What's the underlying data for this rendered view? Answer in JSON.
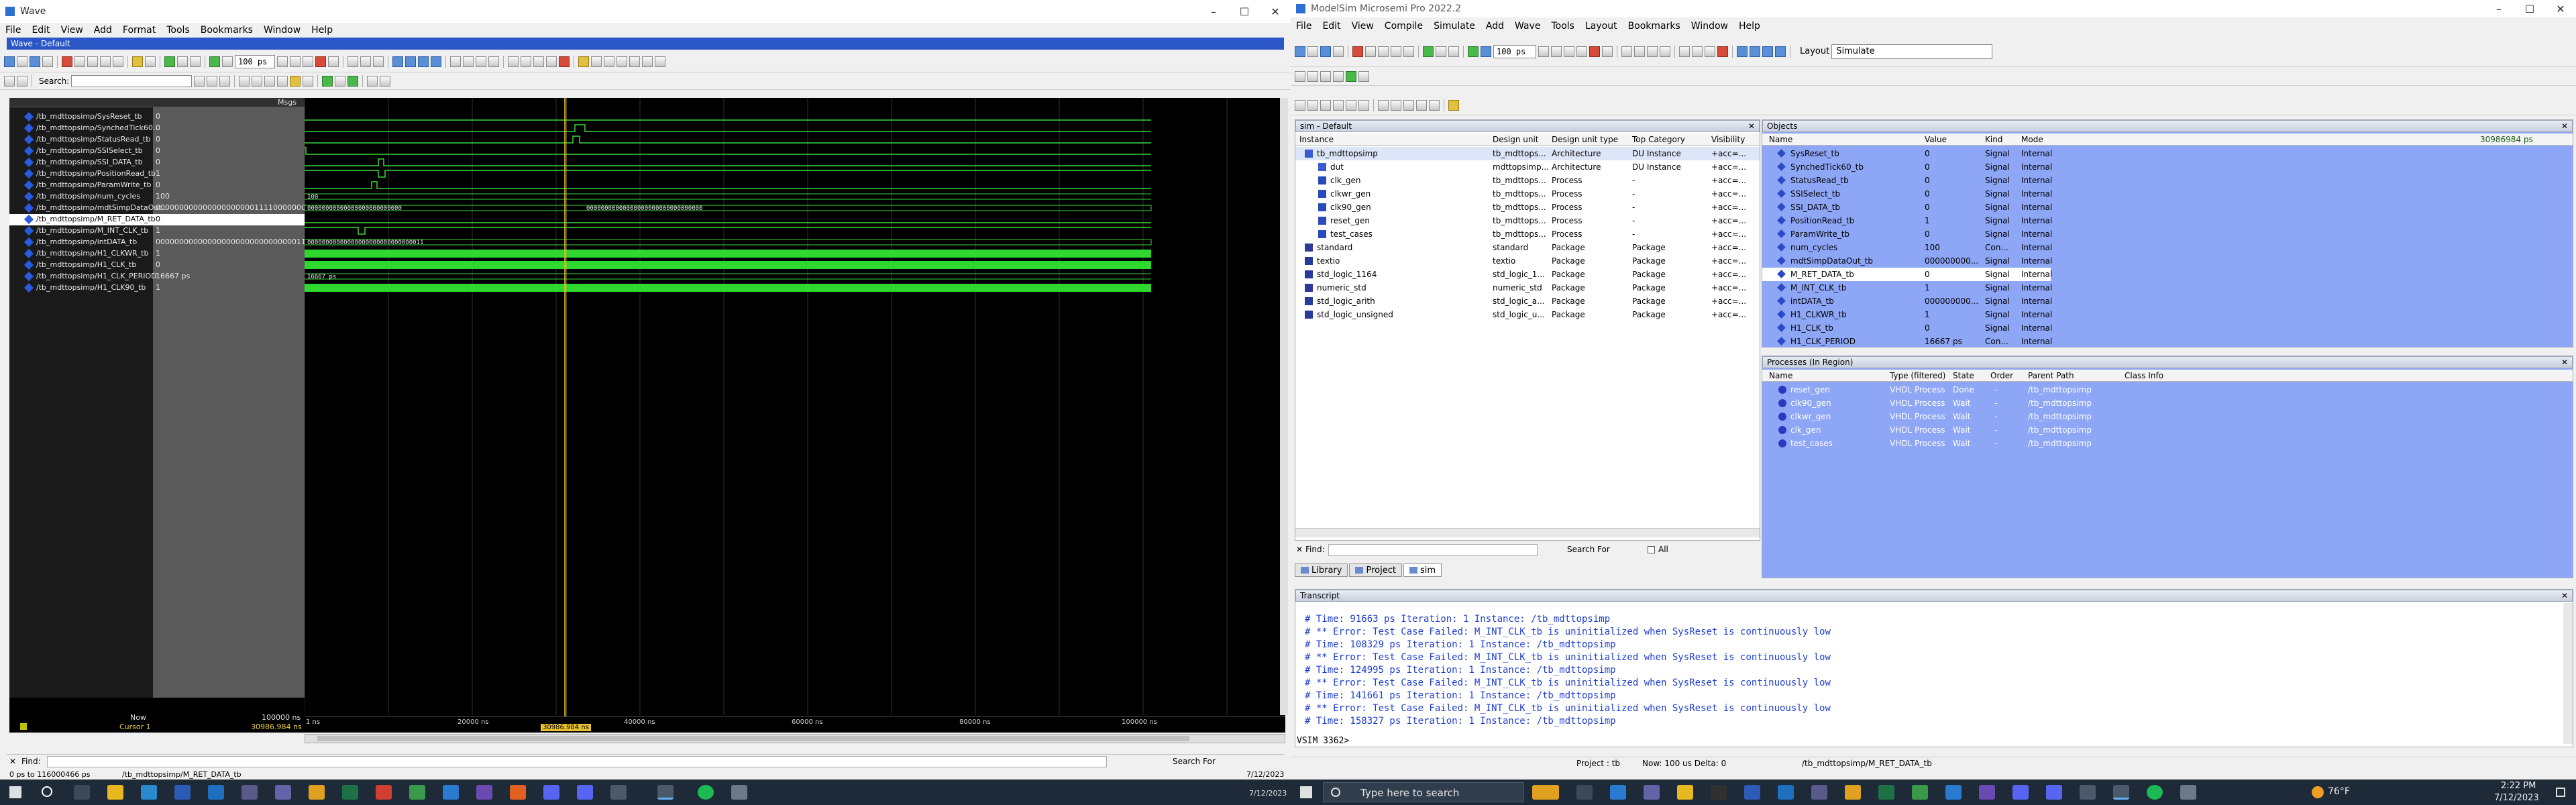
{
  "wave_window": {
    "title": "Wave",
    "menu": [
      "File",
      "Edit",
      "View",
      "Add",
      "Format",
      "Tools",
      "Bookmarks",
      "Window",
      "Help"
    ],
    "pane_title": "Wave - Default",
    "search_label": "Search:",
    "time_step": "100 ps",
    "msgs_header": "Msgs",
    "signals": [
      {
        "name": "/tb_mdttopsimp/SysReset_tb",
        "value": "0"
      },
      {
        "name": "/tb_mdttopsimp/SynchedTick60...",
        "value": "0"
      },
      {
        "name": "/tb_mdttopsimp/StatusRead_tb",
        "value": "0"
      },
      {
        "name": "/tb_mdttopsimp/SSISelect_tb",
        "value": "0"
      },
      {
        "name": "/tb_mdttopsimp/SSI_DATA_tb",
        "value": "0"
      },
      {
        "name": "/tb_mdttopsimp/PositionRead_tb",
        "value": "1"
      },
      {
        "name": "/tb_mdttopsimp/ParamWrite_tb",
        "value": "0"
      },
      {
        "name": "/tb_mdttopsimp/num_cycles",
        "value": "100"
      },
      {
        "name": "/tb_mdttopsimp/mdtSimpDataOut...",
        "value": "00000000000000000000011110000000"
      },
      {
        "name": "/tb_mdttopsimp/M_RET_DATA_tb",
        "value": "0"
      },
      {
        "name": "/tb_mdttopsimp/M_INT_CLK_tb",
        "value": "1"
      },
      {
        "name": "/tb_mdttopsimp/intDATA_tb",
        "value": "00000000000000000000000000000011"
      },
      {
        "name": "/tb_mdttopsimp/H1_CLKWR_tb",
        "value": "1"
      },
      {
        "name": "/tb_mdttopsimp/H1_CLK_tb",
        "value": "0"
      },
      {
        "name": "/tb_mdttopsimp/H1_CLK_PERIOD",
        "value": "16667 ps"
      },
      {
        "name": "/tb_mdttopsimp/H1_CLK90_tb",
        "value": "1"
      }
    ],
    "bus_labels": {
      "num_cycles": "100",
      "dataout_a": "00000000000000000000000000",
      "dataout_b": "00000000000000000000000000000000",
      "intdata": "00000000000000000000000000000011",
      "period": "16667 ps"
    },
    "now_label": "Now",
    "now_value": "100000 ns",
    "cursor_label": "Cursor 1",
    "cursor_value": "30986.984 ns",
    "cursor_tag": "30986.984 ns",
    "ruler": [
      "1 ns",
      "20000 ns",
      "40000 ns",
      "60000 ns",
      "80000 ns",
      "100000 ns"
    ],
    "find_label": "Find:",
    "search_for": "Search For",
    "status_range": "0 ps to 116000466 ps",
    "status_path": "/tb_mdttopsimp/M_RET_DATA_tb",
    "status_date": "7/12/2023"
  },
  "modelsim": {
    "title": "ModelSim Microsemi Pro 2022.2",
    "menu": [
      "File",
      "Edit",
      "View",
      "Compile",
      "Simulate",
      "Add",
      "Wave",
      "Tools",
      "Layout",
      "Bookmarks",
      "Window",
      "Help"
    ],
    "layout_label": "Layout",
    "layout_value": "Simulate",
    "time_step": "100 ps",
    "sim_pane_title": "sim - Default",
    "sim_columns": [
      "Instance",
      "Design unit",
      "Design unit type",
      "Top Category",
      "Visibility"
    ],
    "sim_rows": [
      {
        "instance": "tb_mdttopsimp",
        "unit": "tb_mdttops...",
        "type": "Architecture",
        "cat": "DU Instance",
        "vis": "+acc=..."
      },
      {
        "instance": "dut",
        "unit": "mdttopsimp...",
        "type": "Architecture",
        "cat": "DU Instance",
        "vis": "+acc=..."
      },
      {
        "instance": "clk_gen",
        "unit": "tb_mdttops...",
        "type": "Process",
        "cat": "-",
        "vis": "+acc=..."
      },
      {
        "instance": "clkwr_gen",
        "unit": "tb_mdttops...",
        "type": "Process",
        "cat": "-",
        "vis": "+acc=..."
      },
      {
        "instance": "clk90_gen",
        "unit": "tb_mdttops...",
        "type": "Process",
        "cat": "-",
        "vis": "+acc=..."
      },
      {
        "instance": "reset_gen",
        "unit": "tb_mdttops...",
        "type": "Process",
        "cat": "-",
        "vis": "+acc=..."
      },
      {
        "instance": "test_cases",
        "unit": "tb_mdttops...",
        "type": "Process",
        "cat": "-",
        "vis": "+acc=..."
      },
      {
        "instance": "standard",
        "unit": "standard",
        "type": "Package",
        "cat": "Package",
        "vis": "+acc=..."
      },
      {
        "instance": "textio",
        "unit": "textio",
        "type": "Package",
        "cat": "Package",
        "vis": "+acc=..."
      },
      {
        "instance": "std_logic_1164",
        "unit": "std_logic_1...",
        "type": "Package",
        "cat": "Package",
        "vis": "+acc=..."
      },
      {
        "instance": "numeric_std",
        "unit": "numeric_std",
        "type": "Package",
        "cat": "Package",
        "vis": "+acc=..."
      },
      {
        "instance": "std_logic_arith",
        "unit": "std_logic_a...",
        "type": "Package",
        "cat": "Package",
        "vis": "+acc=..."
      },
      {
        "instance": "std_logic_unsigned",
        "unit": "std_logic_u...",
        "type": "Package",
        "cat": "Package",
        "vis": "+acc=..."
      }
    ],
    "find_label": "Find:",
    "search_for": "Search For",
    "all_label": "All",
    "tabs": [
      "Library",
      "Project",
      "sim"
    ],
    "objects_title": "Objects",
    "objects_columns": [
      "Name",
      "Value",
      "Kind",
      "Mode"
    ],
    "objects_now": "30986984 ps",
    "objects_rows": [
      {
        "name": "SysReset_tb",
        "value": "0",
        "kind": "Signal",
        "mode": "Internal"
      },
      {
        "name": "SynchedTick60_tb",
        "value": "0",
        "kind": "Signal",
        "mode": "Internal"
      },
      {
        "name": "StatusRead_tb",
        "value": "0",
        "kind": "Signal",
        "mode": "Internal"
      },
      {
        "name": "SSISelect_tb",
        "value": "0",
        "kind": "Signal",
        "mode": "Internal"
      },
      {
        "name": "SSI_DATA_tb",
        "value": "0",
        "kind": "Signal",
        "mode": "Internal"
      },
      {
        "name": "PositionRead_tb",
        "value": "1",
        "kind": "Signal",
        "mode": "Internal"
      },
      {
        "name": "ParamWrite_tb",
        "value": "0",
        "kind": "Signal",
        "mode": "Internal"
      },
      {
        "name": "num_cycles",
        "value": "100",
        "kind": "Con...",
        "mode": "Internal"
      },
      {
        "name": "mdtSimpDataOut_tb",
        "value": "000000000...",
        "kind": "Signal",
        "mode": "Internal"
      },
      {
        "name": "M_RET_DATA_tb",
        "value": "0",
        "kind": "Signal",
        "mode": "Internal"
      },
      {
        "name": "M_INT_CLK_tb",
        "value": "1",
        "kind": "Signal",
        "mode": "Internal"
      },
      {
        "name": "intDATA_tb",
        "value": "000000000...",
        "kind": "Signal",
        "mode": "Internal"
      },
      {
        "name": "H1_CLKWR_tb",
        "value": "1",
        "kind": "Signal",
        "mode": "Internal"
      },
      {
        "name": "H1_CLK_tb",
        "value": "0",
        "kind": "Signal",
        "mode": "Internal"
      },
      {
        "name": "H1_CLK_PERIOD",
        "value": "16667 ps",
        "kind": "Con...",
        "mode": "Internal"
      }
    ],
    "processes_title": "Processes (In Region)",
    "processes_columns": [
      "Name",
      "Type (filtered)",
      "State",
      "Order",
      "Parent Path",
      "Class Info"
    ],
    "processes_rows": [
      {
        "name": "reset_gen",
        "type": "VHDL Process",
        "state": "Done",
        "order": "-",
        "path": "/tb_mdttopsimp"
      },
      {
        "name": "clk90_gen",
        "type": "VHDL Process",
        "state": "Wait",
        "order": "-",
        "path": "/tb_mdttopsimp"
      },
      {
        "name": "clkwr_gen",
        "type": "VHDL Process",
        "state": "Wait",
        "order": "-",
        "path": "/tb_mdttopsimp"
      },
      {
        "name": "clk_gen",
        "type": "VHDL Process",
        "state": "Wait",
        "order": "-",
        "path": "/tb_mdttopsimp"
      },
      {
        "name": "test_cases",
        "type": "VHDL Process",
        "state": "Wait",
        "order": "-",
        "path": "/tb_mdttopsimp"
      }
    ],
    "transcript_title": "Transcript",
    "transcript_lines": [
      "#    Time: 91663 ps  Iteration: 1  Instance: /tb_mdttopsimp",
      "# ** Error: Test Case Failed: M_INT_CLK_tb is uninitialized when SysReset is continuously low",
      "#    Time: 108329 ps  Iteration: 1  Instance: /tb_mdttopsimp",
      "# ** Error: Test Case Failed: M_INT_CLK_tb is uninitialized when SysReset is continuously low",
      "#    Time: 124995 ps  Iteration: 1  Instance: /tb_mdttopsimp",
      "# ** Error: Test Case Failed: M_INT_CLK_tb is uninitialized when SysReset is continuously low",
      "#    Time: 141661 ps  Iteration: 1  Instance: /tb_mdttopsimp",
      "# ** Error: Test Case Failed: M_INT_CLK_tb is uninitialized when SysReset is continuously low",
      "#    Time: 158327 ps  Iteration: 1  Instance: /tb_mdttopsimp"
    ],
    "prompt": "VSIM 3362>",
    "status_project": "Project : tb",
    "status_now": "Now: 100 us  Delta: 0",
    "status_path": "/tb_mdttopsimp/M_RET_DATA_tb"
  },
  "taskbar": {
    "search_placeholder": "Type here to search",
    "weather": "76°F",
    "time": "2:22 PM",
    "date": "7/12/2023"
  }
}
